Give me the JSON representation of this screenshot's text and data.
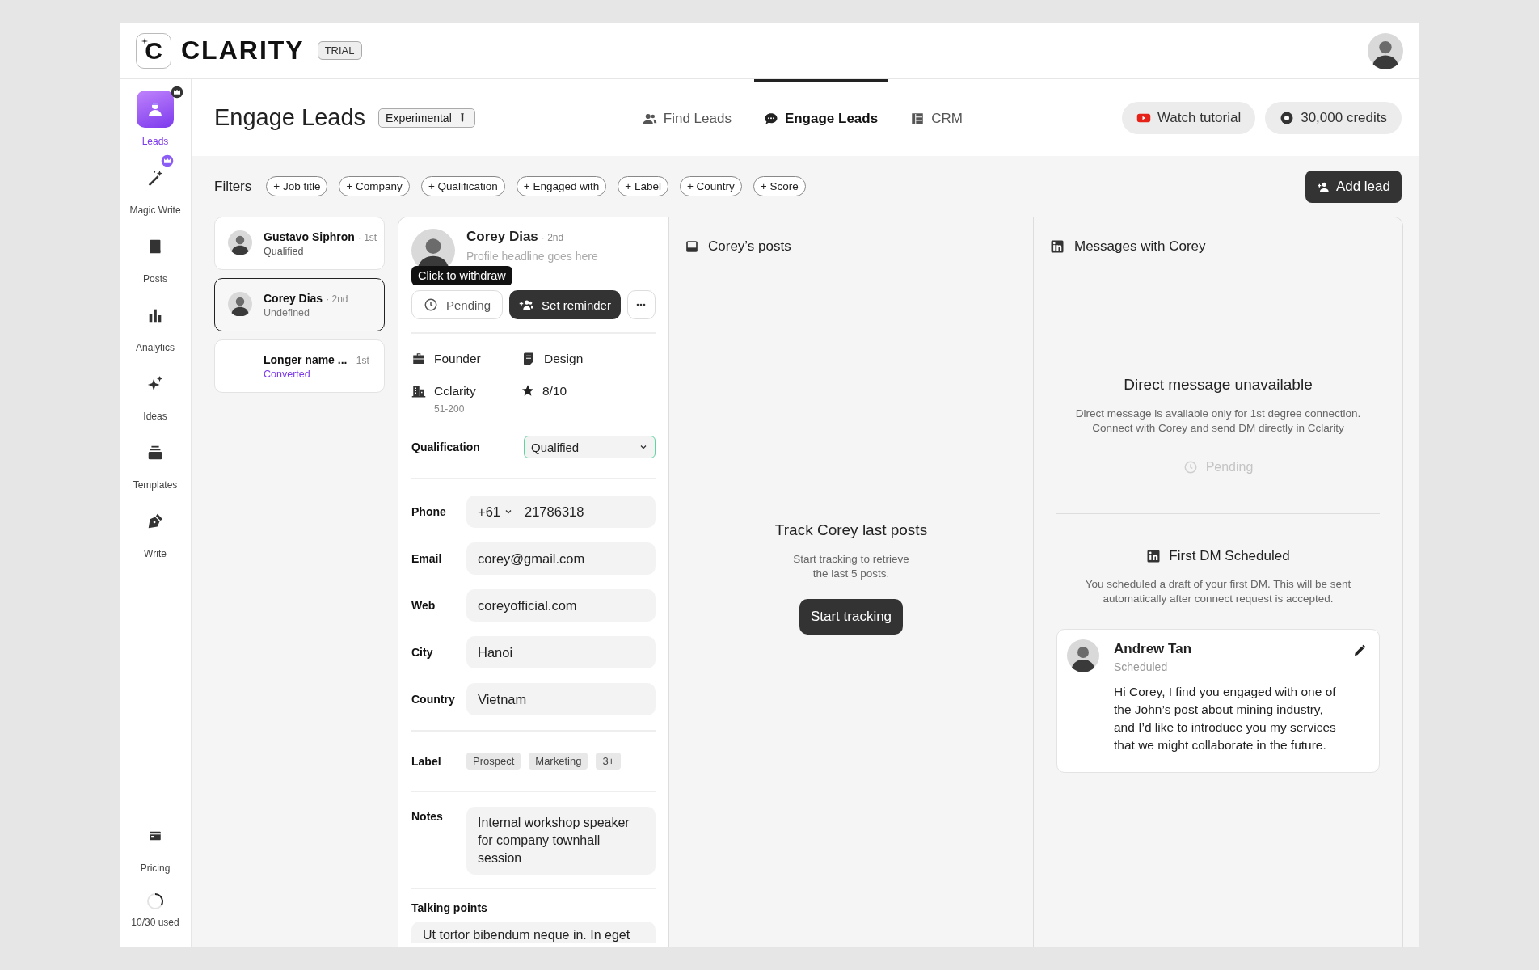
{
  "app": {
    "logo_mark": "C",
    "logo": "CLARITY",
    "plan_badge": "TRIAL"
  },
  "sidebar": {
    "items": [
      {
        "label": "Leads",
        "selected": true,
        "premium": true
      },
      {
        "label": "Magic Write",
        "selected": false,
        "premium": true
      },
      {
        "label": "Posts",
        "selected": false,
        "premium": false
      },
      {
        "label": "Analytics",
        "selected": false,
        "premium": false
      },
      {
        "label": "Ideas",
        "selected": false,
        "premium": false
      },
      {
        "label": "Templates",
        "selected": false,
        "premium": false
      },
      {
        "label": "Write",
        "selected": false,
        "premium": false
      }
    ],
    "pricing": "Pricing",
    "usage": {
      "label": "10/30 used",
      "level": 0.33
    }
  },
  "header": {
    "title": "Engage Leads",
    "tag": "Experimental",
    "tabs": [
      {
        "label": "Find Leads",
        "selected": false
      },
      {
        "label": "Engage Leads",
        "selected": true
      },
      {
        "label": "CRM",
        "selected": false
      }
    ],
    "buttons": [
      "Watch tutorial",
      "30,000 credits"
    ]
  },
  "filters": {
    "label": "Filters",
    "chips": [
      "+ Job title",
      "+ Company",
      "+ Qualification",
      "+ Engaged with",
      "+ Label",
      "+ Country",
      "+ Score"
    ],
    "add_button": "Add lead"
  },
  "leads": [
    {
      "name": "Gustavo Siphron",
      "degree": "· 1st",
      "status": "Qualified",
      "color": "#555555",
      "avatar": true,
      "selected": false
    },
    {
      "name": "Corey Dias",
      "degree": "· 2nd",
      "status": "Undefined",
      "color": "#777777",
      "avatar": true,
      "selected": true
    },
    {
      "name": "Longer name ...",
      "degree": "· 1st",
      "status": "Converted",
      "color": "#7c3aed",
      "avatar": false,
      "selected": false
    }
  ],
  "detail": {
    "name": "Corey Dias",
    "degree": "· 2nd",
    "headline": "Profile headline goes here",
    "tooltip": "Click to withdraw",
    "pending": "Pending",
    "reminder": "Set reminder",
    "attributes": [
      {
        "text": "Founder"
      },
      {
        "text": "Design"
      },
      {
        "text": "Cclarity",
        "sub": "51-200"
      },
      {
        "text": "8/10"
      }
    ],
    "qualification": {
      "label": "Qualification",
      "value": "Qualified"
    },
    "fields": [
      {
        "label": "Phone",
        "prefix": "+61",
        "value": "21786318"
      },
      {
        "label": "Email",
        "value": "corey@gmail.com"
      },
      {
        "label": "Web",
        "value": "coreyofficial.com"
      },
      {
        "label": "City",
        "value": "Hanoi"
      },
      {
        "label": "Country",
        "value": "Vietnam"
      }
    ],
    "labels": {
      "label": "Label",
      "tags": [
        "Prospect",
        "Marketing",
        "3+"
      ]
    },
    "notes": {
      "label": "Notes",
      "value": "Internal workshop speaker for company townhall session"
    },
    "talking_points": {
      "label": "Talking points",
      "value": "Ut tortor bibendum neque in. In eget"
    }
  },
  "posts": {
    "title": "Corey’s posts",
    "empty_title": "Track Corey last posts",
    "empty_text": "Start tracking to retrieve\nthe last 5 posts.",
    "button": "Start tracking"
  },
  "messages": {
    "title": "Messages with Corey",
    "unavailable_title": "Direct message unavailable",
    "unavailable_text": "Direct message is available only for 1st degree connection.\nConnect with Corey and send DM directly in Cclarity",
    "status": "Pending",
    "scheduled_title": "First DM Scheduled",
    "scheduled_text": "You scheduled a draft of your first DM. This will be sent\nautomatically after connect request is accepted.",
    "message": {
      "sender": "Andrew Tan",
      "status": "Scheduled",
      "text": "Hi Corey, I find you engaged with one of the John’s post about mining industry, and I’d like to introduce you my services that we might collaborate in the future."
    }
  }
}
